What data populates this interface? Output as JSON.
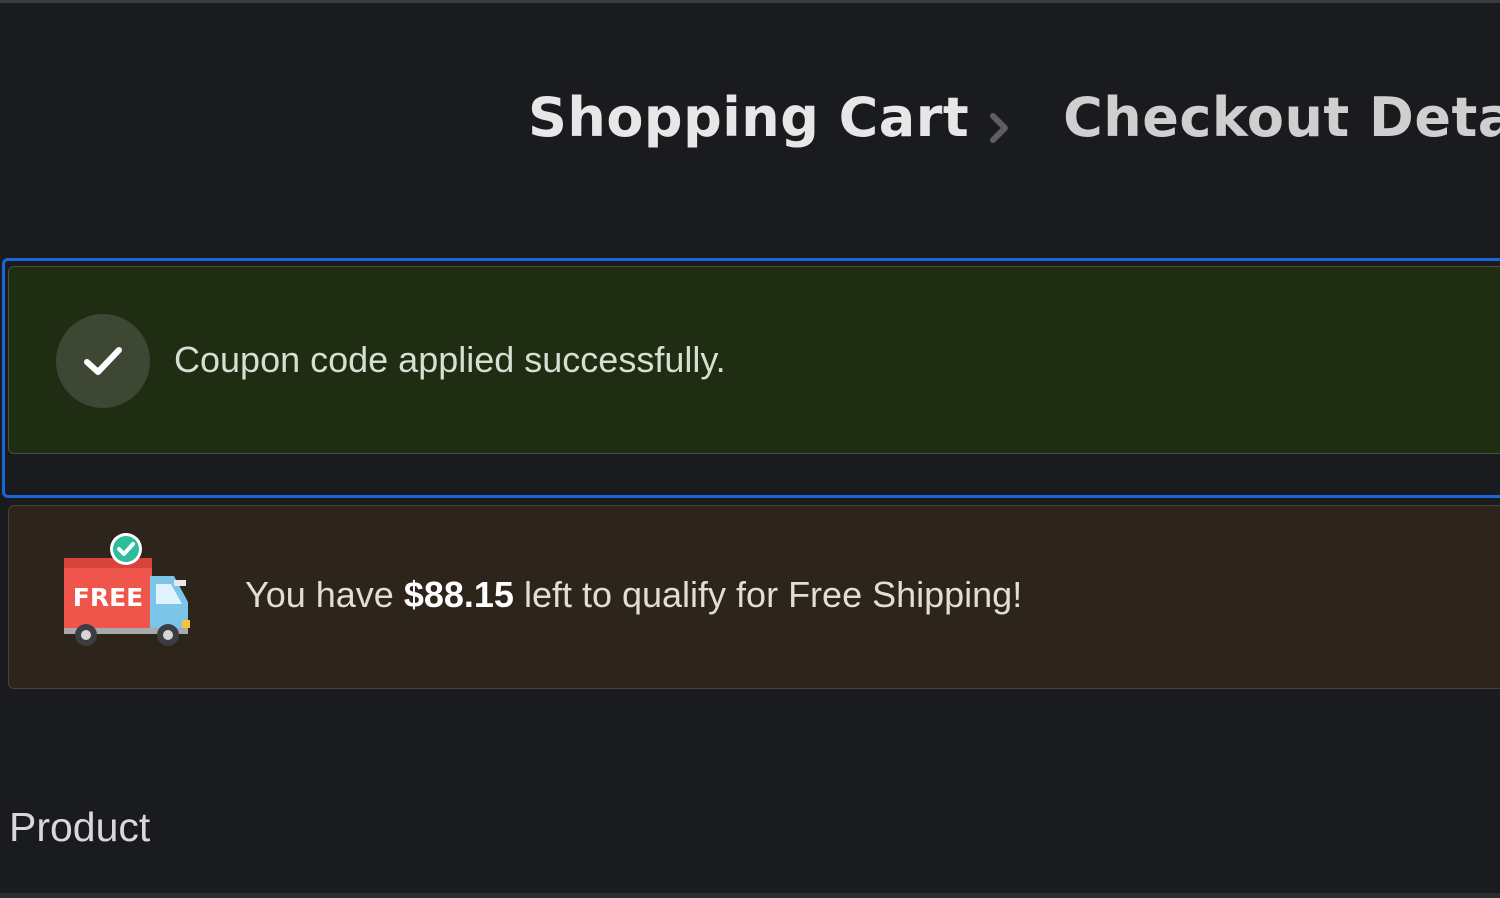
{
  "breadcrumb": {
    "steps": [
      "Shopping Cart",
      "Checkout Deta"
    ],
    "separator_icon": "chevron-right-icon"
  },
  "coupon_notice": {
    "message": "Coupon code applied successfully.",
    "icon": "checkmark-icon",
    "background": "#1f2d12",
    "focus_color": "#1a66d8"
  },
  "shipping_notice": {
    "prefix": "You have ",
    "amount": "$88.15",
    "suffix": " left to qualify for Free Shipping!",
    "icon": "free-shipping-truck-icon",
    "badge_text": "FREE",
    "background": "#2d241b"
  },
  "cart_table": {
    "product_header": "Product"
  }
}
